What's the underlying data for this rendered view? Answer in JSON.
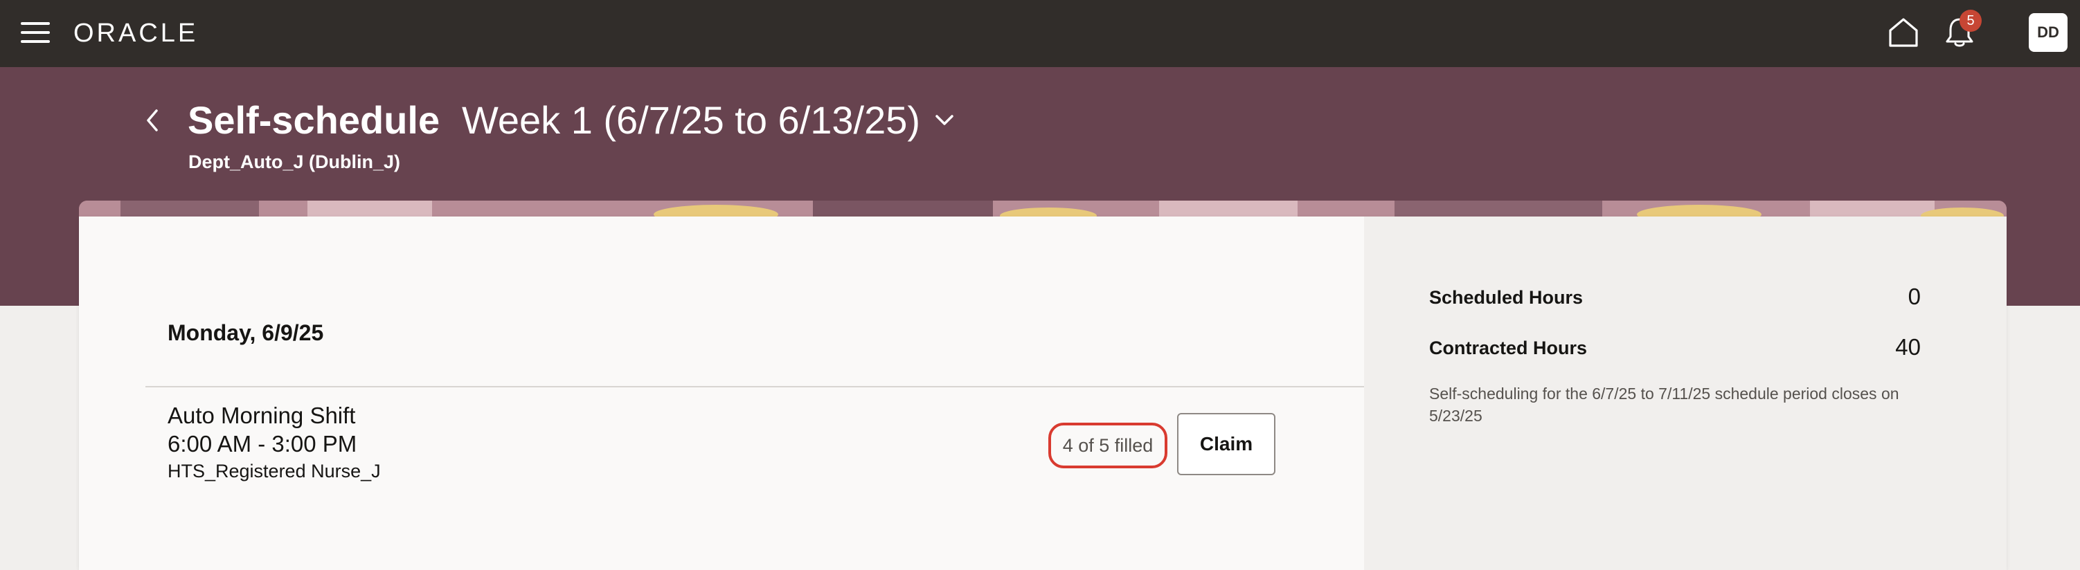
{
  "header": {
    "logo": "ORACLE",
    "notification_count": "5",
    "user_initials": "DD"
  },
  "page": {
    "title": "Self-schedule",
    "week_selector": "Week 1 (6/7/25 to 6/13/25)",
    "department": "Dept_Auto_J (Dublin_J)"
  },
  "schedule": {
    "day": "Monday, 6/9/25",
    "shift": {
      "name": "Auto Morning Shift",
      "time": "6:00 AM - 3:00 PM",
      "role": "HTS_Registered Nurse_J",
      "filled_status": "4 of 5 filled",
      "claim_label": "Claim"
    }
  },
  "summary": {
    "scheduled_label": "Scheduled Hours",
    "scheduled_value": "0",
    "contracted_label": "Contracted Hours",
    "contracted_value": "40",
    "note": "Self-scheduling for the 6/7/25 to 7/11/25 schedule period closes on 5/23/25"
  },
  "colors": {
    "topbar": "#312d2a",
    "hero": "#67434f",
    "badge": "#c74634",
    "highlight": "#d93b30"
  }
}
